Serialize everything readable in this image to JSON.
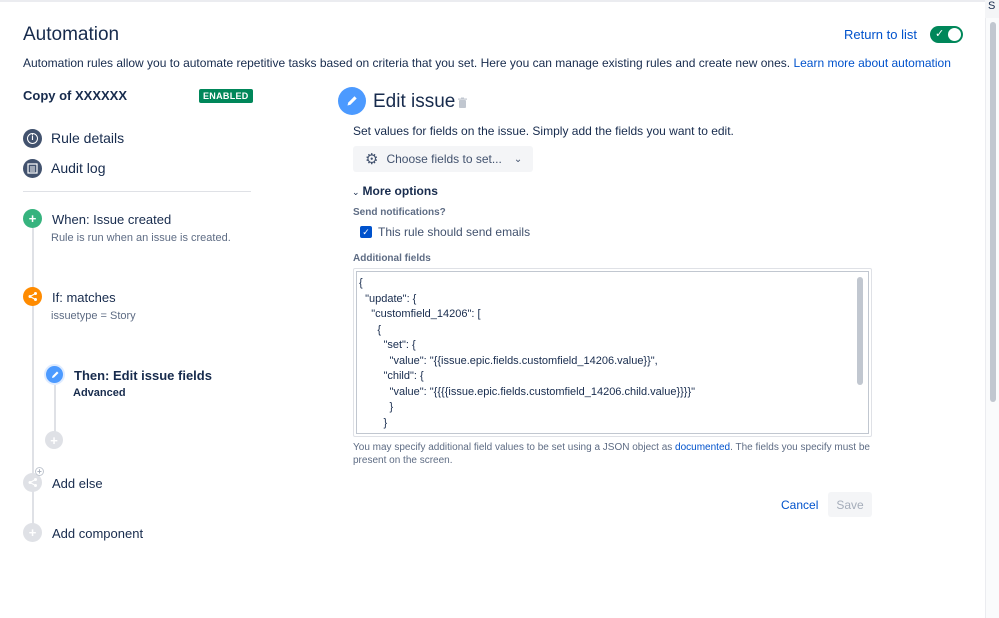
{
  "header": {
    "title": "Automation",
    "return_link": "Return to list",
    "description": "Automation rules allow you to automate repetitive tasks based on criteria that you set. Here you can manage existing rules and create new ones.",
    "learn_more": "Learn more about automation",
    "toggle_state": "on",
    "corner_tab": "S"
  },
  "rule": {
    "name": "Copy of XXXXXX",
    "status_badge": "ENABLED"
  },
  "sidebar": {
    "items": [
      {
        "label": "Rule details",
        "icon": "info-icon"
      },
      {
        "label": "Audit log",
        "icon": "list-icon"
      }
    ]
  },
  "timeline": {
    "trigger": {
      "title": "When: Issue created",
      "subtitle": "Rule is run when an issue is created."
    },
    "condition": {
      "title": "If: matches",
      "subtitle": "issuetype = Story"
    },
    "action": {
      "title": "Then: Edit issue fields",
      "subtitle": "Advanced"
    },
    "add_else": "Add else",
    "add_component": "Add component"
  },
  "editor": {
    "title": "Edit issue",
    "description": "Set values for fields on the issue. Simply add the fields you want to edit.",
    "choose_fields": "Choose fields to set...",
    "more_options": "More options",
    "send_notifications_label": "Send notifications?",
    "send_emails_checkbox": "This rule should send emails",
    "send_emails_checked": true,
    "additional_fields_label": "Additional fields",
    "code_lines": [
      "{",
      "  \"update\": {",
      "    \"customfield_14206\": [",
      "      {",
      "        \"set\": {",
      "          \"value\": \"{{issue.epic.fields.customfield_14206.value}}\",",
      "        \"child\": {",
      "          \"value\": \"{{{{issue.epic.fields.customfield_14206.child.value}}}}\"",
      "          }",
      "        }"
    ],
    "help_prefix": "You may specify additional field values to be set using a JSON object as",
    "help_link": "documented",
    "help_suffix": ". The fields you specify must be present on the screen.",
    "cancel": "Cancel",
    "save": "Save"
  },
  "colors": {
    "link": "#0052cc",
    "enabled": "#00875a",
    "trigger": "#36b37e",
    "condition": "#ff8b00",
    "action": "#4c9aff"
  }
}
